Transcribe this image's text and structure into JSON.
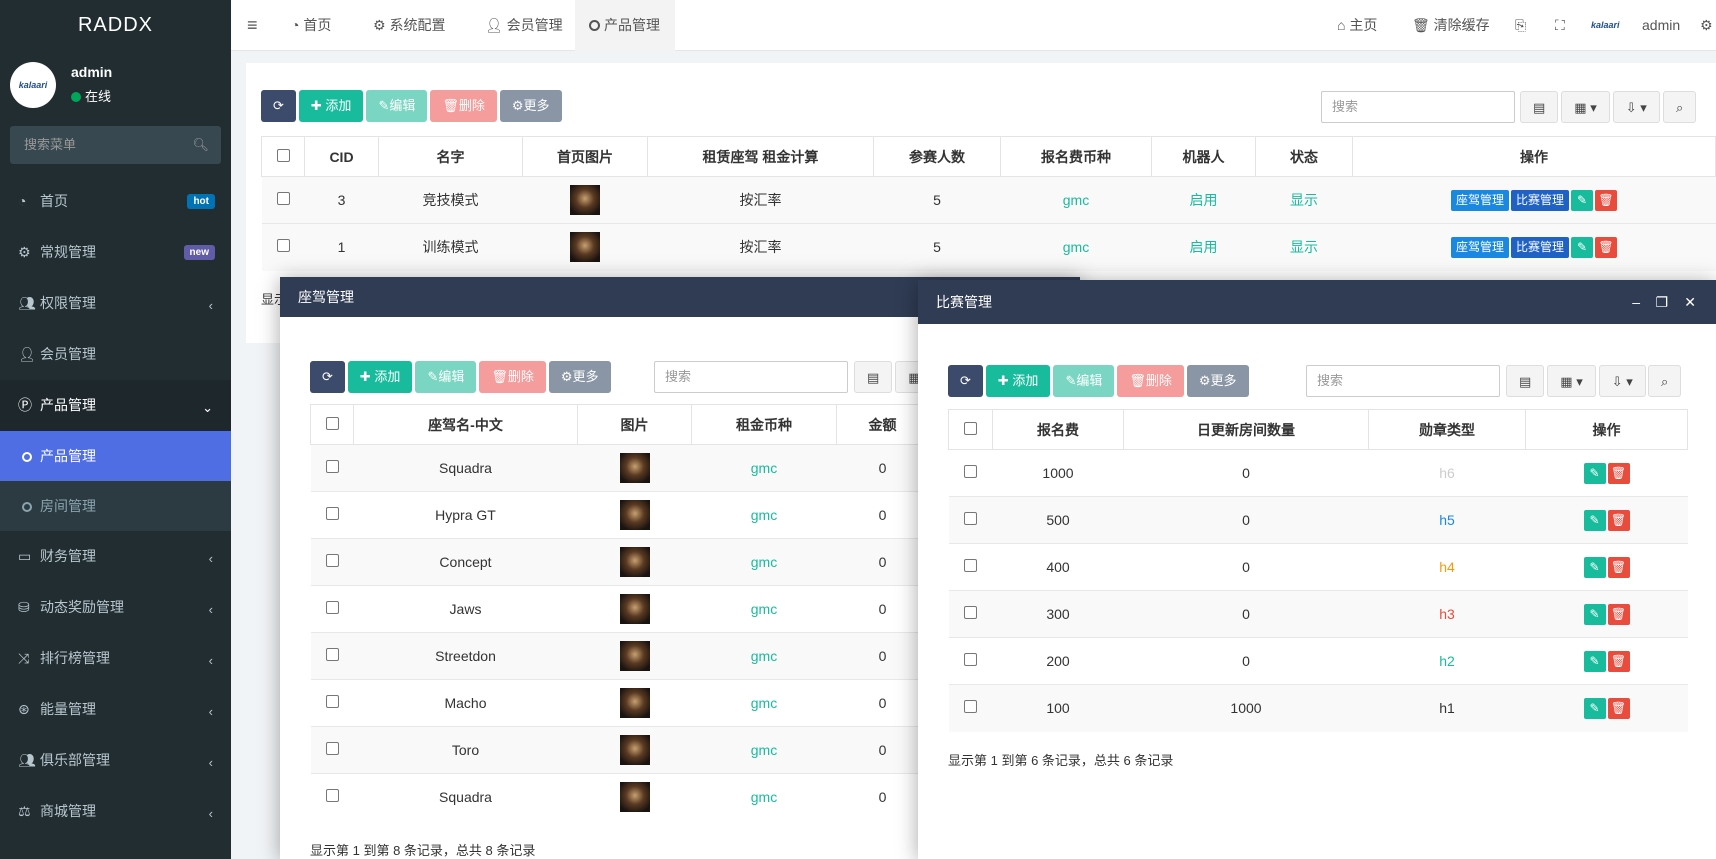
{
  "brand": "RADDX",
  "user": {
    "name": "admin",
    "status": "在线",
    "logo_text": "kalaari"
  },
  "sidebar": {
    "search_placeholder": "搜索菜单",
    "items": [
      {
        "label": "首页",
        "badge": "hot",
        "badge_color": "#0073b7"
      },
      {
        "label": "常规管理",
        "badge": "new",
        "badge_color": "#605ca8"
      },
      {
        "label": "权限管理"
      },
      {
        "label": "会员管理"
      },
      {
        "label": "产品管理"
      },
      {
        "label": "财务管理"
      },
      {
        "label": "动态奖励管理"
      },
      {
        "label": "排行榜管理"
      },
      {
        "label": "能量管理"
      },
      {
        "label": "俱乐部管理"
      },
      {
        "label": "商城管理"
      }
    ],
    "sub_items": [
      {
        "label": "产品管理"
      },
      {
        "label": "房间管理"
      }
    ]
  },
  "topbar": {
    "tabs": [
      {
        "label": "首页"
      },
      {
        "label": "系统配置"
      },
      {
        "label": "会员管理"
      },
      {
        "label": "产品管理"
      }
    ],
    "right": {
      "home": "主页",
      "clear_cache": "清除缓存",
      "user": "admin"
    }
  },
  "toolbar": {
    "add": "添加",
    "edit": "编辑",
    "delete": "删除",
    "more": "更多",
    "search_placeholder": "搜索"
  },
  "main_table": {
    "headers": [
      "CID",
      "名字",
      "首页图片",
      "租赁座驾 租金计算",
      "参赛人数",
      "报名费币种",
      "机器人",
      "状态",
      "操作"
    ],
    "rows": [
      {
        "cid": "3",
        "name": "竞技模式",
        "calc": "按汇率",
        "count": "5",
        "currency": "gmc",
        "robot": "启用",
        "status": "显示"
      },
      {
        "cid": "1",
        "name": "训练模式",
        "calc": "按汇率",
        "count": "5",
        "currency": "gmc",
        "robot": "启用",
        "status": "显示"
      }
    ],
    "actions": {
      "seat": "座驾管理",
      "match": "比赛管理"
    },
    "footer_partial": "显示"
  },
  "car_layer": {
    "title": "座驾管理",
    "headers": [
      "座驾名-中文",
      "图片",
      "租金币种",
      "金额"
    ],
    "rows": [
      {
        "name": "Squadra",
        "currency": "gmc",
        "amount": "0"
      },
      {
        "name": "Hypra GT",
        "currency": "gmc",
        "amount": "0"
      },
      {
        "name": "Concept",
        "currency": "gmc",
        "amount": "0"
      },
      {
        "name": "Jaws",
        "currency": "gmc",
        "amount": "0"
      },
      {
        "name": "Streetdon",
        "currency": "gmc",
        "amount": "0"
      },
      {
        "name": "Macho",
        "currency": "gmc",
        "amount": "0"
      },
      {
        "name": "Toro",
        "currency": "gmc",
        "amount": "0"
      },
      {
        "name": "Squadra",
        "currency": "gmc",
        "amount": "0"
      }
    ],
    "footer": "显示第 1 到第 8 条记录，总共 8 条记录"
  },
  "match_layer": {
    "title": "比赛管理",
    "headers": [
      "报名费",
      "日更新房间数量",
      "勋章类型",
      "操作"
    ],
    "rows": [
      {
        "fee": "1000",
        "rooms": "0",
        "medal": "h6",
        "color": "#cccccc"
      },
      {
        "fee": "500",
        "rooms": "0",
        "medal": "h5",
        "color": "#1a88e0"
      },
      {
        "fee": "400",
        "rooms": "0",
        "medal": "h4",
        "color": "#f39c12"
      },
      {
        "fee": "300",
        "rooms": "0",
        "medal": "h3",
        "color": "#e74c3c"
      },
      {
        "fee": "200",
        "rooms": "0",
        "medal": "h2",
        "color": "#18bc9c"
      },
      {
        "fee": "100",
        "rooms": "1000",
        "medal": "h1",
        "color": "#333333"
      }
    ],
    "footer": "显示第 1 到第 6 条记录，总共 6 条记录"
  }
}
